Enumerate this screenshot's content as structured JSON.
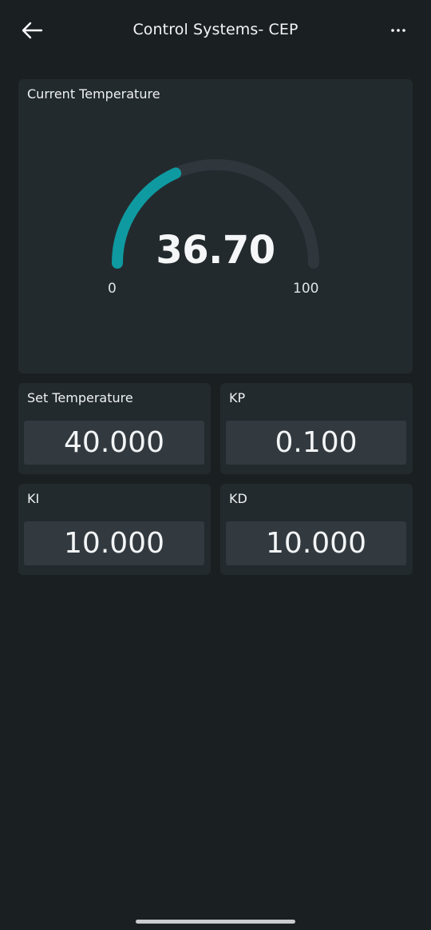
{
  "header": {
    "title": "Control Systems- CEP",
    "back_icon": "arrow-left-icon",
    "more_icon": "more-horizontal-icon"
  },
  "gauge": {
    "label": "Current Temperature",
    "value": "36.70",
    "value_number": 36.7,
    "min": "0",
    "max": "100",
    "min_number": 0,
    "max_number": 100,
    "fill_color": "#0e9aa0",
    "track_color": "#2f363c"
  },
  "params": {
    "set_temperature": {
      "label": "Set Temperature",
      "value": "40.000"
    },
    "kp": {
      "label": "KP",
      "value": "0.100"
    },
    "ki": {
      "label": "KI",
      "value": "10.000"
    },
    "kd": {
      "label": "KD",
      "value": "10.000"
    }
  },
  "colors": {
    "background": "#1a1f22",
    "card": "#232a2e",
    "input": "#323a40",
    "accent": "#0e9aa0"
  }
}
